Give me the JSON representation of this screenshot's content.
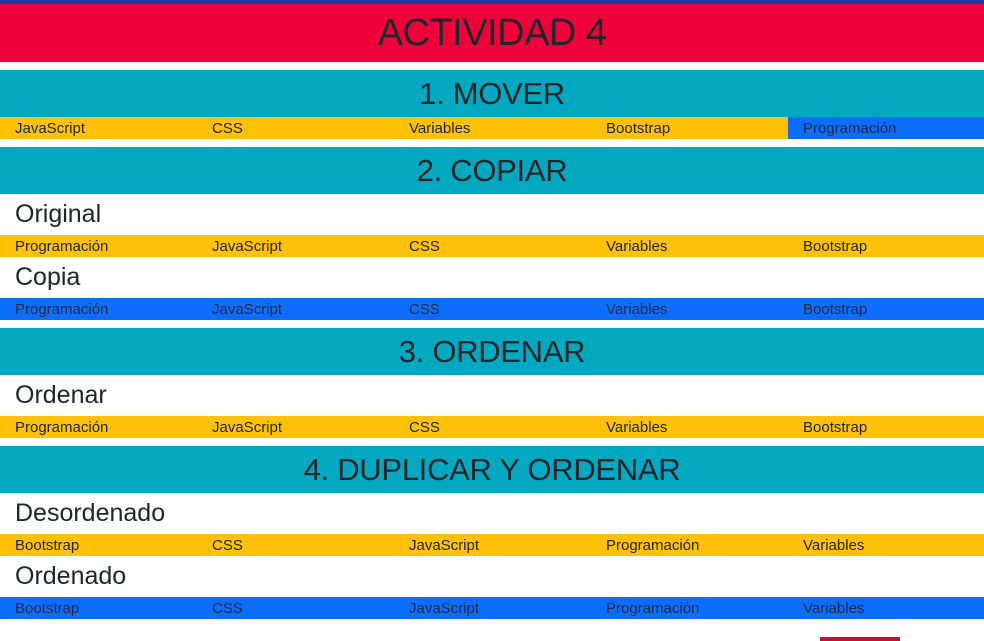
{
  "main_title": "ACTIVIDAD 4",
  "colors": {
    "main_title_bg": "#f0003a",
    "section_bg": "#02a7c0",
    "item_yellow": "#ffc107",
    "item_blue": "#0d6efd"
  },
  "sections": [
    {
      "title": "1. MOVER",
      "rows": [
        {
          "items": [
            {
              "label": "JavaScript",
              "color": "yellow"
            },
            {
              "label": "CSS",
              "color": "yellow"
            },
            {
              "label": "Variables",
              "color": "yellow"
            },
            {
              "label": "Bootstrap",
              "color": "yellow"
            },
            {
              "label": "Programación",
              "color": "blue"
            }
          ]
        }
      ]
    },
    {
      "title": "2. COPIAR",
      "rows": [
        {
          "subtitle": "Original",
          "items": [
            {
              "label": "Programación",
              "color": "yellow"
            },
            {
              "label": "JavaScript",
              "color": "yellow"
            },
            {
              "label": "CSS",
              "color": "yellow"
            },
            {
              "label": "Variables",
              "color": "yellow"
            },
            {
              "label": "Bootstrap",
              "color": "yellow"
            }
          ]
        },
        {
          "subtitle": "Copia",
          "items": [
            {
              "label": "Programación",
              "color": "blue"
            },
            {
              "label": "JavaScript",
              "color": "blue"
            },
            {
              "label": "CSS",
              "color": "blue"
            },
            {
              "label": "Variables",
              "color": "blue"
            },
            {
              "label": "Bootstrap",
              "color": "blue"
            }
          ]
        }
      ]
    },
    {
      "title": "3. ORDENAR",
      "rows": [
        {
          "subtitle": "Ordenar",
          "items": [
            {
              "label": "Programación",
              "color": "yellow"
            },
            {
              "label": "JavaScript",
              "color": "yellow"
            },
            {
              "label": "CSS",
              "color": "yellow"
            },
            {
              "label": "Variables",
              "color": "yellow"
            },
            {
              "label": "Bootstrap",
              "color": "yellow"
            }
          ]
        }
      ]
    },
    {
      "title": "4. DUPLICAR Y ORDENAR",
      "rows": [
        {
          "subtitle": "Desordenado",
          "items": [
            {
              "label": "Bootstrap",
              "color": "yellow"
            },
            {
              "label": "CSS",
              "color": "yellow"
            },
            {
              "label": "JavaScript",
              "color": "yellow"
            },
            {
              "label": "Programación",
              "color": "yellow"
            },
            {
              "label": "Variables",
              "color": "yellow"
            }
          ]
        },
        {
          "subtitle": "Ordenado",
          "items": [
            {
              "label": "Bootstrap",
              "color": "blue"
            },
            {
              "label": "CSS",
              "color": "blue"
            },
            {
              "label": "JavaScript",
              "color": "blue"
            },
            {
              "label": "Programación",
              "color": "blue"
            },
            {
              "label": "Variables",
              "color": "blue"
            }
          ]
        }
      ]
    }
  ]
}
